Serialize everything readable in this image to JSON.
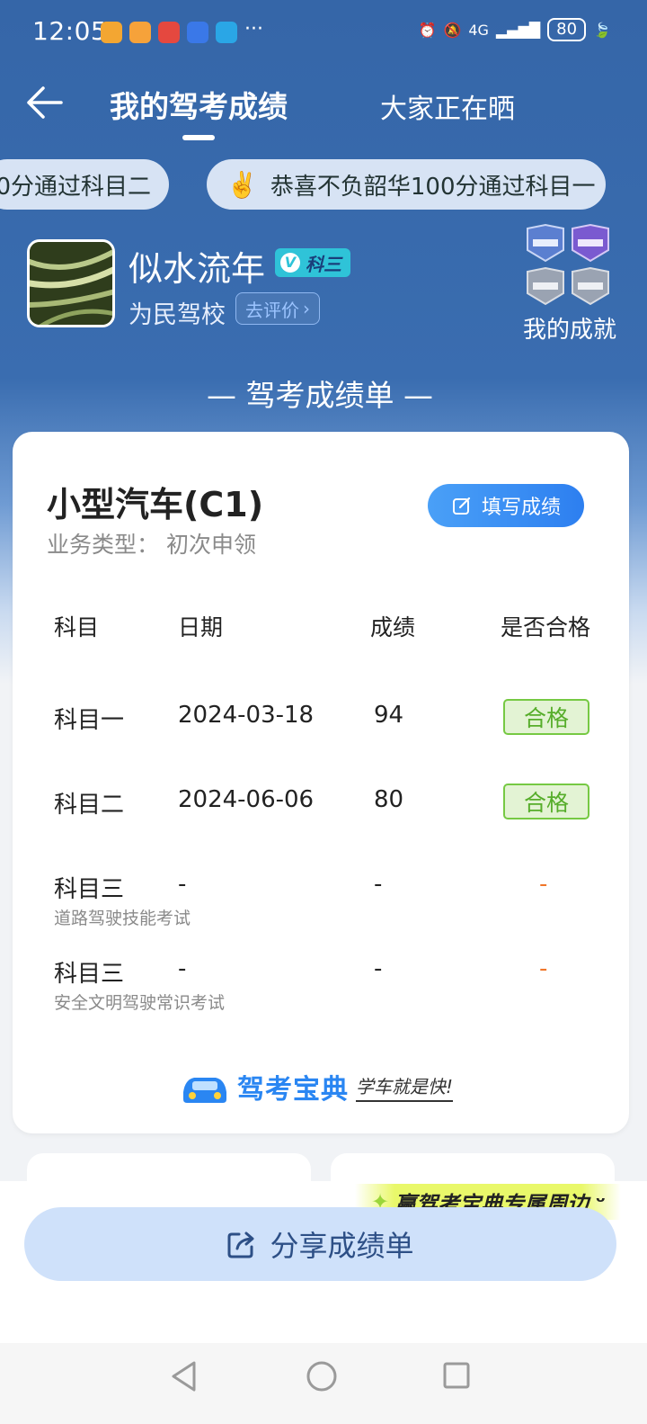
{
  "status_bar": {
    "time": "12:05",
    "more": "···",
    "network": "4G",
    "battery": "80"
  },
  "header": {
    "tab_active": "我的驾考成绩",
    "tab_other": "大家正在晒"
  },
  "ticker": {
    "pill1": "0分通过科目二",
    "pill2_emoji": "✌️",
    "pill2": "恭喜不负韶华100分通过科目一"
  },
  "profile": {
    "username": "似水流年",
    "badge": "科三",
    "school": "为民驾校",
    "rate_button": "去评价",
    "achievements_label": "我的成就"
  },
  "section_title": "— 驾考成绩单 —",
  "card": {
    "car_type": "小型汽车(C1)",
    "business": "业务类型：  初次申领",
    "fill_button": "填写成绩",
    "headers": [
      "科目",
      "日期",
      "成绩",
      "是否合格"
    ],
    "rows": [
      {
        "subject": "科目一",
        "sub": "",
        "date": "2024-03-18",
        "score": "94",
        "result": "合格"
      },
      {
        "subject": "科目二",
        "sub": "",
        "date": "2024-06-06",
        "score": "80",
        "result": "合格"
      },
      {
        "subject": "科目三",
        "sub": "道路驾驶技能考试",
        "date": "-",
        "score": "-",
        "result": "-"
      },
      {
        "subject": "科目三",
        "sub": "安全文明驾驶常识考试",
        "date": "-",
        "score": "-",
        "result": "-"
      }
    ],
    "brand_name": "驾考宝典",
    "brand_slogan": "学车就是快!"
  },
  "promo_text": "赢驾考宝典专属周边",
  "share_button": "分享成绩单",
  "colors": {
    "header_blue": "#3566a8",
    "pass_green": "#56ad2a",
    "accent_blue": "#2d7ff0",
    "dash_orange": "#f0762a"
  }
}
